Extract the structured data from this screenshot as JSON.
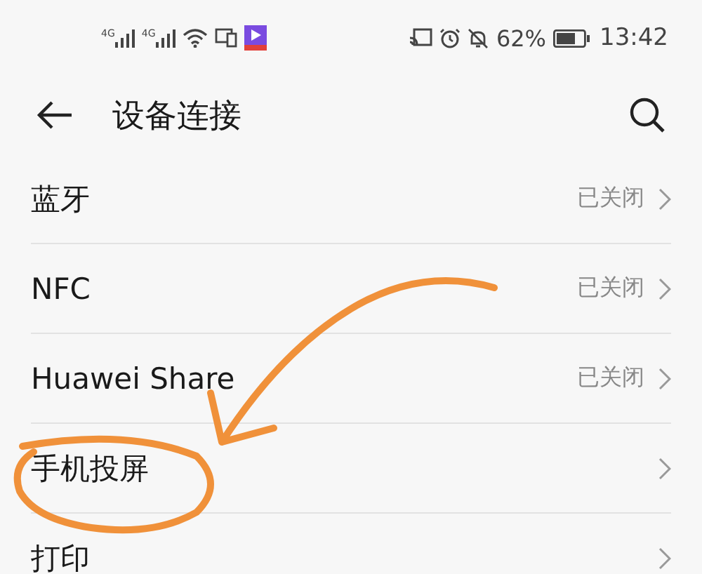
{
  "status_bar": {
    "signals": [
      "4G",
      "4G"
    ],
    "battery": "62%",
    "time": "13:42"
  },
  "header": {
    "title": "设备连接"
  },
  "rows": [
    {
      "label": "蓝牙",
      "value": "已关闭"
    },
    {
      "label": "NFC",
      "value": "已关闭"
    },
    {
      "label": "Huawei Share",
      "value": "已关闭"
    },
    {
      "label": "手机投屏"
    },
    {
      "label": "打印"
    }
  ]
}
